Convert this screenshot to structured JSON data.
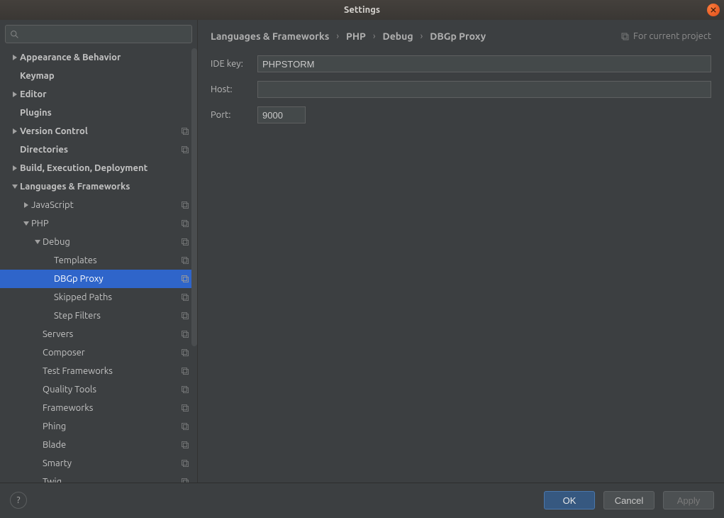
{
  "window": {
    "title": "Settings"
  },
  "search": {
    "placeholder": ""
  },
  "tree": [
    {
      "label": "Appearance & Behavior",
      "indent": 0,
      "arrow": "right",
      "bold": true,
      "proj": false
    },
    {
      "label": "Keymap",
      "indent": 0,
      "arrow": "none",
      "bold": true,
      "proj": false
    },
    {
      "label": "Editor",
      "indent": 0,
      "arrow": "right",
      "bold": true,
      "proj": false
    },
    {
      "label": "Plugins",
      "indent": 0,
      "arrow": "none",
      "bold": true,
      "proj": false
    },
    {
      "label": "Version Control",
      "indent": 0,
      "arrow": "right",
      "bold": true,
      "proj": true
    },
    {
      "label": "Directories",
      "indent": 0,
      "arrow": "none",
      "bold": true,
      "proj": true
    },
    {
      "label": "Build, Execution, Deployment",
      "indent": 0,
      "arrow": "right",
      "bold": true,
      "proj": false
    },
    {
      "label": "Languages & Frameworks",
      "indent": 0,
      "arrow": "down",
      "bold": true,
      "proj": false
    },
    {
      "label": "JavaScript",
      "indent": 1,
      "arrow": "right",
      "bold": false,
      "proj": true
    },
    {
      "label": "PHP",
      "indent": 1,
      "arrow": "down",
      "bold": false,
      "proj": true
    },
    {
      "label": "Debug",
      "indent": 2,
      "arrow": "down",
      "bold": false,
      "proj": true
    },
    {
      "label": "Templates",
      "indent": 3,
      "arrow": "none",
      "bold": false,
      "proj": true
    },
    {
      "label": "DBGp Proxy",
      "indent": 3,
      "arrow": "none",
      "bold": false,
      "proj": true,
      "selected": true
    },
    {
      "label": "Skipped Paths",
      "indent": 3,
      "arrow": "none",
      "bold": false,
      "proj": true
    },
    {
      "label": "Step Filters",
      "indent": 3,
      "arrow": "none",
      "bold": false,
      "proj": true
    },
    {
      "label": "Servers",
      "indent": 2,
      "arrow": "none",
      "bold": false,
      "proj": true
    },
    {
      "label": "Composer",
      "indent": 2,
      "arrow": "none",
      "bold": false,
      "proj": true
    },
    {
      "label": "Test Frameworks",
      "indent": 2,
      "arrow": "none",
      "bold": false,
      "proj": true
    },
    {
      "label": "Quality Tools",
      "indent": 2,
      "arrow": "none",
      "bold": false,
      "proj": true
    },
    {
      "label": "Frameworks",
      "indent": 2,
      "arrow": "none",
      "bold": false,
      "proj": true
    },
    {
      "label": "Phing",
      "indent": 2,
      "arrow": "none",
      "bold": false,
      "proj": true
    },
    {
      "label": "Blade",
      "indent": 2,
      "arrow": "none",
      "bold": false,
      "proj": true
    },
    {
      "label": "Smarty",
      "indent": 2,
      "arrow": "none",
      "bold": false,
      "proj": true
    },
    {
      "label": "Twig",
      "indent": 2,
      "arrow": "none",
      "bold": false,
      "proj": true
    }
  ],
  "breadcrumb": {
    "items": [
      "Languages & Frameworks",
      "PHP",
      "Debug",
      "DBGp Proxy"
    ],
    "scope": "For current project"
  },
  "form": {
    "ide_key": {
      "label": "IDE key:",
      "value": "PHPSTORM"
    },
    "host": {
      "label": "Host:",
      "value": ""
    },
    "port": {
      "label": "Port:",
      "value": "9000"
    }
  },
  "footer": {
    "ok": "OK",
    "cancel": "Cancel",
    "apply": "Apply",
    "help": "?"
  }
}
